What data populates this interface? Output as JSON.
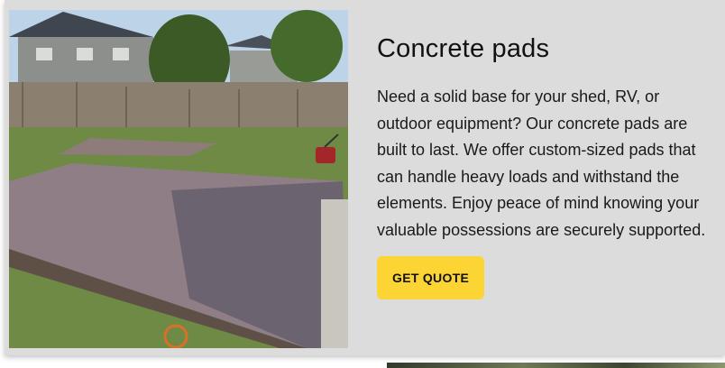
{
  "card": {
    "title": "Concrete pads",
    "description": "Need a solid base for your shed, RV, or outdoor equipment? Our concrete pads are built to last. We offer custom-sized pads that can handle heavy loads and withstand the elements. Enjoy peace of mind knowing your valuable possessions are securely supported.",
    "cta_label": "GET QUOTE",
    "image_subject": "concrete-pad-photo"
  },
  "colors": {
    "card_background": "#dcdcdc",
    "cta_background": "#fcd535",
    "text": "#111111"
  }
}
